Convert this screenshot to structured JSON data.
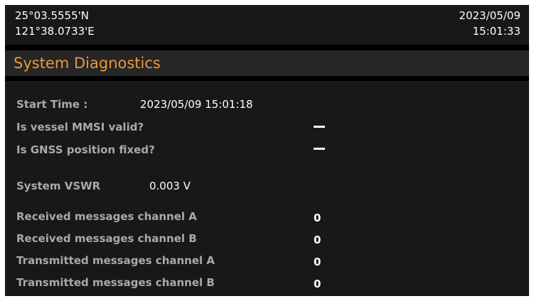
{
  "status_bar": {
    "latitude": "25°03.5555'N",
    "longitude": "121°38.0733'E",
    "date": "2023/05/09",
    "time": "15:01:33"
  },
  "page": {
    "title": "System Diagnostics"
  },
  "diagnostics": {
    "start_time_label": "Start Time :",
    "start_time_value": "2023/05/09 15:01:18",
    "mmsi_valid_label": "Is vessel MMSI valid?",
    "mmsi_valid_value": "—",
    "gnss_fixed_label": "Is GNSS position fixed?",
    "gnss_fixed_value": "—",
    "vswr_label": "System VSWR",
    "vswr_value": "0.003 V"
  },
  "counters": [
    {
      "label": "Received messages channel A",
      "value": "0"
    },
    {
      "label": "Received messages channel B",
      "value": "0"
    },
    {
      "label": "Transmitted messages channel A",
      "value": "0"
    },
    {
      "label": "Transmitted messages channel B",
      "value": "0"
    }
  ],
  "colors": {
    "title_accent": "#e8993c",
    "label_text": "#a9a9a9",
    "value_text": "#ffffff",
    "panel_bg": "#181818",
    "title_bg": "#262626"
  }
}
